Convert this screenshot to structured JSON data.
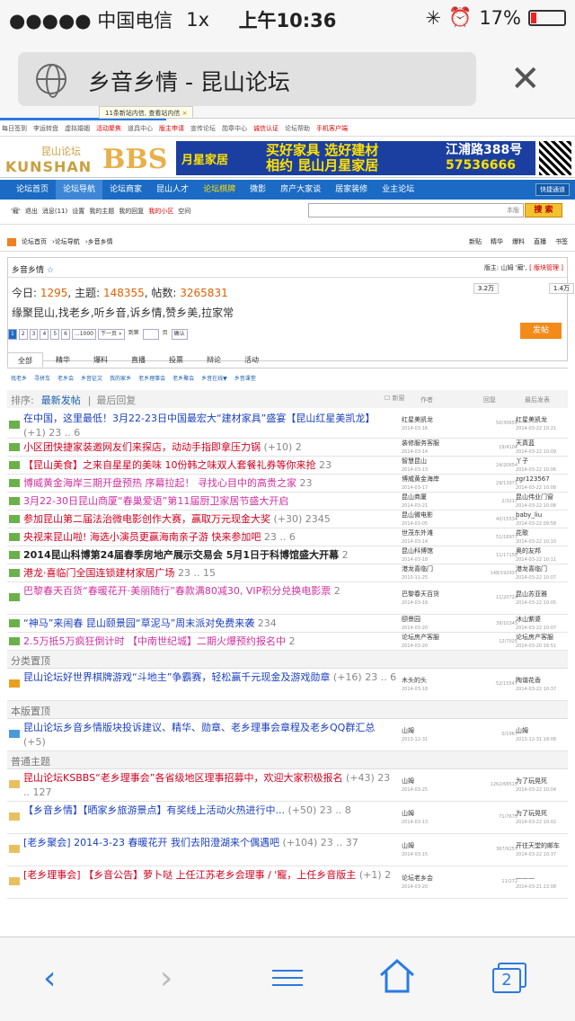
{
  "status_bar": {
    "carrier": "●●●●● 中国电信",
    "network": "1x",
    "time": "上午10:36",
    "battery": "17%"
  },
  "browser": {
    "title": "乡音乡情 - 昆山论坛",
    "tab_count": "2"
  },
  "site": {
    "top_links": [
      "每日签到",
      "李运转盘",
      "虚拟婚姻",
      "活动聚焦",
      "道具中心",
      "版主申请",
      "宣传论坛",
      "勋章中心",
      "诚信认证",
      "论坛帮助",
      "手机客户端"
    ],
    "logo_cn": "昆山论坛",
    "logo_en": "KUNSHAN",
    "logo_bbs": "BBS",
    "ad": {
      "brand": "月星家居",
      "line1": "买好家具 选好建材",
      "line2": "相约 昆山月星家居",
      "line3": "江浦路388号",
      "phone": "57536666"
    },
    "nav": [
      "论坛首页",
      "论坛导航",
      "论坛商家",
      "昆山人才",
      "论坛棋牌",
      "微影",
      "房产大家谈",
      "居家装修",
      "业主论坛"
    ],
    "quick_nav": "快捷通道",
    "user_links": [
      "'寵'",
      "退出",
      "消息(11)",
      "设置",
      "我的主题",
      "我的回复",
      "我的小区",
      "空间"
    ],
    "search_scope": "本版",
    "search_button": "搜 索",
    "tip": "11条新站内信, 查看站内信",
    "breadcrumb": [
      "论坛首页",
      "论坛导航",
      "乡音乡情"
    ],
    "crumb_right": [
      "新贴",
      "精华",
      "爆料",
      "直播",
      "书签"
    ]
  },
  "board": {
    "name": "乡音乡情",
    "moderators_label": "版主:",
    "moderators": "山姆 '寵',",
    "apply": "[ 版块管理 ]",
    "today_label": "今日:",
    "today": "1295",
    "topics_label": "主题:",
    "topics": "148355",
    "posts_label": "帖数:",
    "posts": "3265831",
    "badge1": "3.2万",
    "badge2": "1.4万",
    "desc": "缘聚昆山,找老乡,听乡音,诉乡情,赞乡美,拉家常",
    "pages": [
      "1",
      "2",
      "3",
      "4",
      "5",
      "6",
      "...1000",
      "下一页 »",
      "到第",
      "页",
      "确认"
    ],
    "post_button": "发帖",
    "tabs": [
      "全部",
      "精华",
      "爆料",
      "直播",
      "投票",
      "辩论",
      "活动"
    ],
    "subtabs": [
      "找老乡",
      "寻拼车",
      "老乡会",
      "乡音征文",
      "我的家乡",
      "老乡理事会",
      "老乡聚会",
      "乡音在线▼",
      "乡音课堂"
    ],
    "sort_label": "排序:",
    "sort_new": "最新发帖",
    "sort_reply": "最后回复",
    "new_window": "新窗",
    "col_author": "作者",
    "col_reply": "回复",
    "col_last": "最后发表",
    "sections": {
      "category": "分类置顶",
      "board": "本版置顶",
      "normal": "普通主题"
    }
  },
  "threads": [
    {
      "title": "在中国，这里最低！3月22-23日中国最宏大“建材家具”盛宴【昆山红星美凯龙】",
      "meta": "(+1)  23 .. 6",
      "author": "红星美凯龙",
      "adate": "2014-03-16",
      "reply": "50/30655",
      "last": "红星美凯龙",
      "ldate": "2014-03-22 10:21"
    },
    {
      "title": "小区团快捷家装邀网友们来探店，动动手指即拿压力锅",
      "meta": "(+10)  2",
      "author": "装修服务客服",
      "adate": "2014-03-14",
      "reply": "19/4104",
      "last": "天真蓝",
      "ldate": "2014-03-22 10:09"
    },
    {
      "title": "【昆山美食】之来自星星的美味 10份韩之味双人套餐礼券等你来抢",
      "meta": "23",
      "author": "智慧昆山",
      "adate": "2014-03-13",
      "reply": "24/20654",
      "last": "丫子",
      "ldate": "2014-03-22 10:06"
    },
    {
      "title": "博威黄金海岸三期开盘预热 序幕拉起！ 寻找心目中的高贵之家",
      "meta": "23",
      "author": "博威黄金海岸",
      "adate": "2014-03-17",
      "reply": "29/13971",
      "last": "zgr123567",
      "ldate": "2014-03-22 10:08"
    },
    {
      "title": "3月22-30日昆山商厦“春巢爱语”第11届厨卫家居节盛大开启",
      "meta": "",
      "author": "昆山商厦",
      "adate": "2014-03-21",
      "reply": "2/3217",
      "last": "昆山伟业门窗",
      "ldate": "2014-03-22 10:08"
    },
    {
      "title": "参加昆山第二届法治微电影创作大赛，赢取万元现金大奖",
      "meta": "(+30)  2345",
      "author": "昆山微电影",
      "adate": "2014-03-05",
      "reply": "40/15534",
      "last": "baby_liu",
      "ldate": "2014-03-22 09:58"
    },
    {
      "title": "央视来昆山啦! 海选小演员更赢海南亲子游 快来参加吧",
      "meta": "23 .. 6",
      "author": "世茂东外滩",
      "adate": "2014-03-14",
      "reply": "51/18977",
      "last": "花歌",
      "ldate": "2014-03-22 10:10"
    },
    {
      "title": "2014昆山科博第24届春季房地产展示交易会 5月1日于科博馆盛大开幕",
      "meta": "2",
      "author": "昆山科博馆",
      "adate": "2014-03-18",
      "reply": "11/17158",
      "last": "奥的友邦",
      "ldate": "2014-03-22 10:11"
    },
    {
      "title": "港龙·喜临门全国连锁建材家居广场",
      "meta": "23 .. 15",
      "author": "港龙喜临门",
      "adate": "2013-11-25",
      "reply": "148/192937",
      "last": "港龙喜临门",
      "ldate": "2014-03-22 10:07"
    },
    {
      "title": "巴黎春天百货“春暖花开·美丽随行”春款满80减30, VIP积分兑换电影票",
      "meta": "2",
      "author": "巴黎春天百货",
      "adate": "2014-03-18",
      "reply": "11/20724",
      "last": "昆山苏亚雅",
      "ldate": "2014-03-22 10:05"
    },
    {
      "title": "“神马”来闹春 昆山颐景园“草泥马”周末派对免费来袭",
      "meta": "234",
      "author": "颐景园",
      "adate": "2014-03-20",
      "reply": "39/10345",
      "last": "冰山紫婆",
      "ldate": "2014-03-22 10:07"
    },
    {
      "title": "2.5万抵5万疯狂倒计时 【中南世纪城】二期火爆预约报名中",
      "meta": "2",
      "author": "论坛房产客服",
      "adate": "2014-03-20",
      "reply": "12/7025",
      "last": "论坛房产客服",
      "ldate": "2014-03-20 16:51"
    },
    {
      "title": "昆山论坛好世界棋牌游戏“斗地主”争霸赛，轻松赢千元现金及游戏勋章",
      "meta": "(+16)  23 .. 6",
      "author": "木头的头",
      "adate": "2014-03-18",
      "reply": "52/15547",
      "last": "陶谐花香",
      "ldate": "2014-03-22 10:37"
    },
    {
      "title": "昆山论坛乡音乡情版块投诉建议、精华、勋章、老乡理事会章程及老乡QQ群汇总",
      "meta": "(+5)",
      "author": "山姆",
      "adate": "2013-12-31",
      "reply": "0/1967",
      "last": "山姆",
      "ldate": "2013-12-31 18:08"
    },
    {
      "title": "昆山论坛KSBBS“老乡理事会”各省级地区理事招募中，欢迎大家积极报名",
      "meta": "(+43)  23 .. 127",
      "author": "山姆",
      "adate": "2014-03-25",
      "reply": "1262/68515",
      "last": "为了玩晃死",
      "ldate": "2014-03-22 10:04"
    },
    {
      "title": "【乡音乡情】【晒家乡旅游景点】有奖线上活动火热进行中...",
      "meta": "(+50)  23 .. 8",
      "author": "山姆",
      "adate": "2014-03-13",
      "reply": "71/7675",
      "last": "为了玩晃死",
      "ldate": "2014-03-22 10:02"
    },
    {
      "title": "[老乡聚会] 2014-3-23 春暖花开 我们去阳澄湖来个偶遇吧",
      "meta": "(+104)  23 .. 37",
      "author": "山姆",
      "adate": "2014-03-15",
      "reply": "367/9257",
      "last": "开往天堂的邮车",
      "ldate": "2014-03-22 10:37"
    },
    {
      "title": "[老乡理事会] 【乡音公告】萝卜哒 上任江苏老乡会理事 / '寵，上任乡音版主",
      "meta": "(+1)  2",
      "author": "论坛老乡会",
      "adate": "2014-03-20",
      "reply": "11/272",
      "last": "———",
      "ldate": "2014-03-21 22:08"
    }
  ]
}
